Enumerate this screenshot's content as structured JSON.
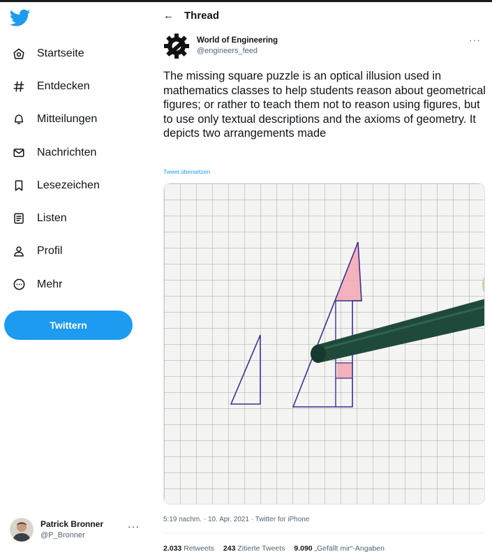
{
  "colors": {
    "accent": "#1d9bf0",
    "text": "#0f1419",
    "muted": "#536471"
  },
  "logo": {
    "icon": "twitter-bird-icon"
  },
  "nav": [
    {
      "label": "Startseite",
      "icon": "home-icon"
    },
    {
      "label": "Entdecken",
      "icon": "hashtag-icon"
    },
    {
      "label": "Mitteilungen",
      "icon": "bell-icon"
    },
    {
      "label": "Nachrichten",
      "icon": "envelope-icon"
    },
    {
      "label": "Lesezeichen",
      "icon": "bookmark-icon"
    },
    {
      "label": "Listen",
      "icon": "list-icon"
    },
    {
      "label": "Profil",
      "icon": "person-icon"
    },
    {
      "label": "Mehr",
      "icon": "more-circle-icon"
    }
  ],
  "tweet_button": "Twittern",
  "profile": {
    "name": "Patrick Bronner",
    "handle": "@P_Bronner",
    "more": "···"
  },
  "header": {
    "back": "←",
    "title": "Thread"
  },
  "tweet": {
    "author_name": "World of Engineering",
    "author_handle": "@engineers_feed",
    "more": "···",
    "text": "The missing square puzzle is an optical illusion used in mathematics classes to help students reason about geometrical figures; or rather to teach them not to reason using figures, but to use only textual descriptions and the axioms of geometry. It depicts two arrangements made",
    "translate": "Tweet übersetzen",
    "time": "5:19 nachm.",
    "date": "10. Apr. 2021",
    "source": "Twitter for iPhone",
    "separator": " · ",
    "stats": {
      "retweets_count": "2.033",
      "retweets_label": "Retweets",
      "quotes_count": "243",
      "quotes_label": "Zitierte Tweets",
      "likes_count": "9.090",
      "likes_label": "„Gefällt mir“-Angaben"
    }
  }
}
